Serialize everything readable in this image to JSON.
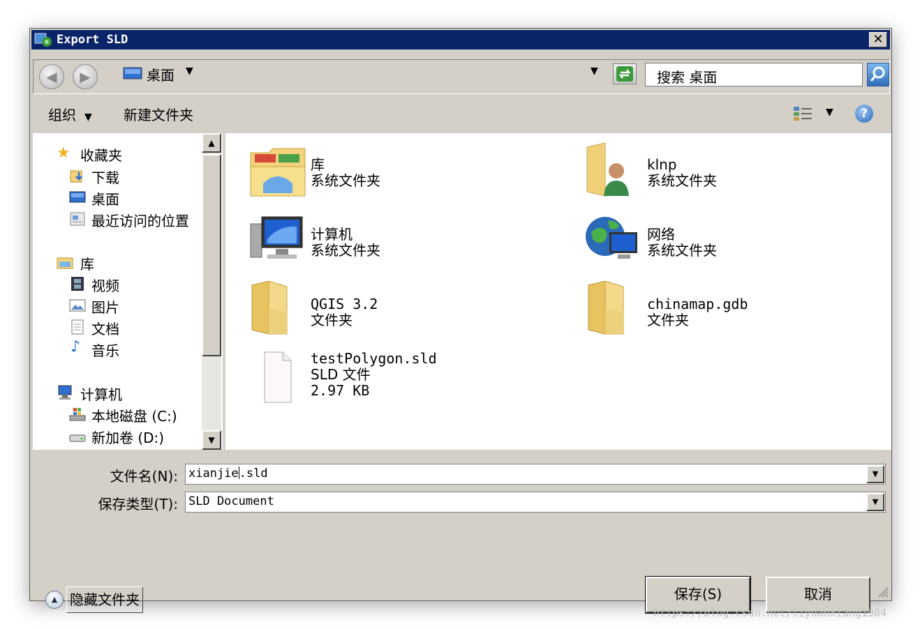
{
  "window": {
    "title": "Export SLD"
  },
  "address": {
    "location": "桌面",
    "search_placeholder": "搜索 桌面"
  },
  "toolbar": {
    "organize": "组织",
    "new_folder": "新建文件夹"
  },
  "nav": {
    "favorites": {
      "label": "收藏夹",
      "items": [
        "下载",
        "桌面",
        "最近访问的位置"
      ]
    },
    "libraries": {
      "label": "库",
      "items": [
        "视频",
        "图片",
        "文档",
        "音乐"
      ]
    },
    "computer": {
      "label": "计算机",
      "items": [
        "本地磁盘 (C:)",
        "新加卷 (D:)"
      ]
    }
  },
  "files": [
    {
      "name": "库",
      "type": "系统文件夹",
      "icon": "library-icon"
    },
    {
      "name": "klnp",
      "type": "系统文件夹",
      "icon": "user-folder-icon"
    },
    {
      "name": "计算机",
      "type": "系统文件夹",
      "icon": "computer-icon"
    },
    {
      "name": "网络",
      "type": "系统文件夹",
      "icon": "network-icon"
    },
    {
      "name": "QGIS 3.2",
      "type": "文件夹",
      "icon": "folder-icon"
    },
    {
      "name": "chinamap.gdb",
      "type": "文件夹",
      "icon": "folder-icon"
    },
    {
      "name": "testPolygon.sld",
      "type": "SLD 文件",
      "size": "2.97 KB",
      "icon": "file-icon"
    }
  ],
  "form": {
    "filename_label": "文件名(N):",
    "filename_value_before_cursor": "xianjie",
    "filename_value_after_cursor": ".sld",
    "filetype_label": "保存类型(T):",
    "filetype_value": "SLD Document"
  },
  "buttons": {
    "hide_folders": "隐藏文件夹",
    "save": "保存(S)",
    "cancel": "取消"
  },
  "watermark": "https://blog.csdn.net/liyuanxiang1984"
}
